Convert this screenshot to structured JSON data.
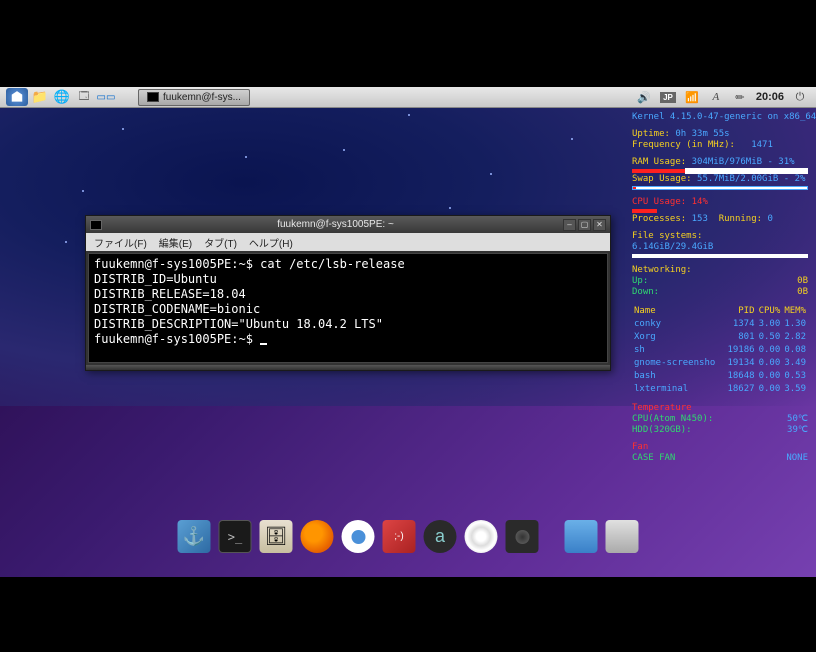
{
  "panel": {
    "taskbar_label": "fuukemn@f-sys...",
    "input_lang": "JP",
    "clock": "20:06"
  },
  "terminal": {
    "title": "fuukemn@f-sys1005PE: ~",
    "menu": {
      "file": "ファイル(F)",
      "edit": "編集(E)",
      "tabs": "タブ(T)",
      "help": "ヘルプ(H)"
    },
    "prompt1": "fuukemn@f-sys1005PE:~$ ",
    "command1": "cat /etc/lsb-release",
    "output": [
      "DISTRIB_ID=Ubuntu",
      "DISTRIB_RELEASE=18.04",
      "DISTRIB_CODENAME=bionic",
      "DISTRIB_DESCRIPTION=\"Ubuntu 18.04.2 LTS\""
    ],
    "prompt2": "fuukemn@f-sys1005PE:~$ "
  },
  "conky": {
    "kernel": "Kernel 4.15.0-47-generic on x86_64",
    "uptime_label": "Uptime:",
    "uptime": "0h 33m 55s",
    "freq_label": "Frequency (in MHz):",
    "freq": "1471",
    "ram_label": "RAM Usage:",
    "ram": "304MiB/976MiB - 31%",
    "swap_label": "Swap Usage:",
    "swap": "55.7MiB/2.00GiB - 2%",
    "cpu_label": "CPU Usage:",
    "cpu": "14%",
    "proc_label": "Processes:",
    "proc_count": "153",
    "running_label": "Running:",
    "running": "0",
    "fs_label": "File systems:",
    "fs": "6.14GiB/29.4GiB",
    "net_label": "Networking:",
    "up_label": "Up:",
    "up": "0B",
    "down_label": "Down:",
    "down": "0B",
    "proc_header": {
      "name": "Name",
      "pid": "PID",
      "cpu": "CPU%",
      "mem": "MEM%"
    },
    "processes": [
      {
        "name": "conky",
        "pid": "1374",
        "cpu": "3.00",
        "mem": "1.30"
      },
      {
        "name": "Xorg",
        "pid": "801",
        "cpu": "0.50",
        "mem": "2.82"
      },
      {
        "name": "sh",
        "pid": "19186",
        "cpu": "0.00",
        "mem": "0.08"
      },
      {
        "name": "gnome-screensho",
        "pid": "19134",
        "cpu": "0.00",
        "mem": "3.49"
      },
      {
        "name": "bash",
        "pid": "18648",
        "cpu": "0.00",
        "mem": "0.53"
      },
      {
        "name": "lxterminal",
        "pid": "18627",
        "cpu": "0.00",
        "mem": "3.59"
      }
    ],
    "temp_header": "Temperature",
    "cpu_temp_label": "CPU(Atom N450):",
    "cpu_temp": "50℃",
    "hdd_temp_label": "HDD(320GB):",
    "hdd_temp": "39℃",
    "fan_header": "Fan",
    "fan_label": "CASE FAN",
    "fan_value": "NONE"
  },
  "dock": {
    "items": [
      "anchor",
      "terminal",
      "file-manager",
      "firefox",
      "chromium",
      "daemon",
      "atom",
      "disc",
      "camera",
      "folder",
      "drive"
    ]
  }
}
